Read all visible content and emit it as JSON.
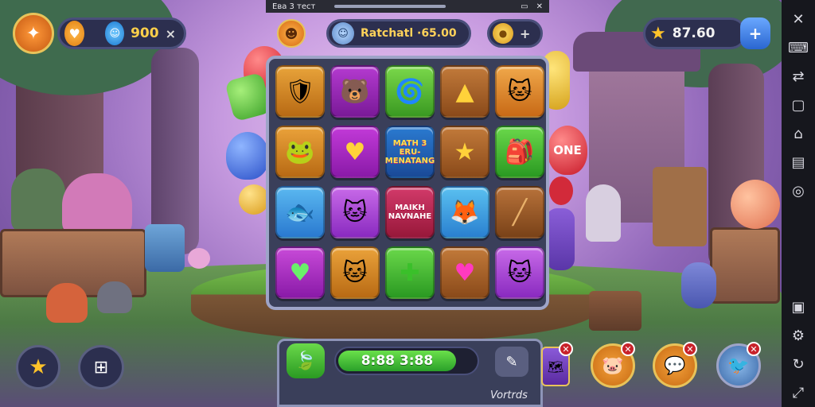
{
  "window_title": "Ева 3 тест",
  "top_left": {
    "coins_value": "900",
    "close_label": "×"
  },
  "top_center": {
    "player_label": "Ratchatl ·65.00",
    "add_label": "+"
  },
  "top_right": {
    "stars_value": "87.60"
  },
  "board": {
    "special_tile_text": "MATH 3\nERU-\nMENATANG",
    "heart_tile_text": "MAIKH\nNAVNAHE",
    "one_text": "ONE"
  },
  "bottom": {
    "timer_value": "8:88 3:88",
    "footer_text": "Vortrds"
  },
  "colors": {
    "accent": "#e8c35a",
    "panel": "#2c2f4f",
    "progress": "#4cbe3a"
  }
}
